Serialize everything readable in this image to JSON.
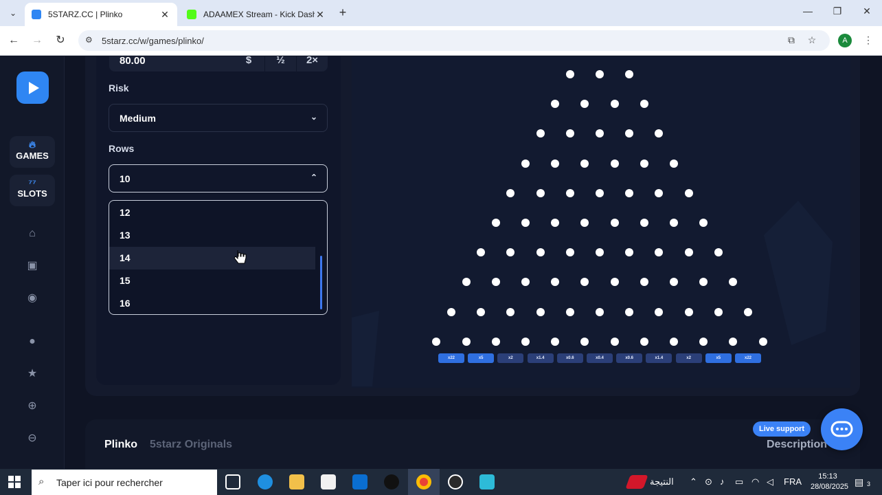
{
  "browser": {
    "tabs": [
      {
        "title": "5STARZ.CC | Plinko",
        "active": true
      },
      {
        "title": "ADAAMEX Stream - Kick Dashb",
        "active": false
      }
    ],
    "url": "5starz.cc/w/games/plinko/",
    "profile_initial": "A"
  },
  "sidebar": {
    "games_label": "GAMES",
    "slots_label": "SLOTS"
  },
  "controls": {
    "bet_amount": "80.00",
    "currency_symbol": "$",
    "half_label": "½",
    "double_label": "2×",
    "risk_label": "Risk",
    "risk_value": "Medium",
    "rows_label": "Rows",
    "rows_value": "10",
    "rows_options": [
      "12",
      "13",
      "14",
      "15",
      "16"
    ],
    "hovered_option": "14"
  },
  "board": {
    "rows": 10,
    "multipliers": [
      "x22",
      "x5",
      "x2",
      "x1.4",
      "x0.6",
      "x0.4",
      "x0.6",
      "x1.4",
      "x2",
      "x5",
      "x22"
    ]
  },
  "footer": {
    "title": "Plinko",
    "subtitle": "5starz Originals",
    "description_tab": "Description",
    "live_support": "Live support"
  },
  "taskbar": {
    "search_placeholder": "Taper ici pour rechercher",
    "news_label": "النتيجة",
    "language": "FRA",
    "time": "15:13",
    "date": "28/08/2025",
    "notification_count": "3"
  },
  "colors": {
    "accent": "#3b82f6",
    "background": "#0f1424",
    "slot_edge": "#2f6fe0",
    "slot_mid": "#2b3f78"
  }
}
